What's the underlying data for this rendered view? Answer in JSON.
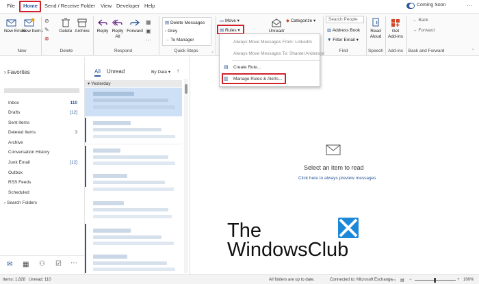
{
  "tabs": [
    "File",
    "Home",
    "Send / Receive",
    "Folder",
    "View",
    "Developer",
    "Help"
  ],
  "coming_soon": "Coming Soon",
  "toggle_state": "On",
  "ribbon": {
    "new_email": "New Email",
    "new_items": "New Items",
    "delete": "Delete",
    "archive": "Archive",
    "reply": "Reply",
    "reply_all": "Reply All",
    "forward": "Forward",
    "quick_steps": [
      "Delete Messages",
      "Grey",
      "To Manager"
    ],
    "move": "Move",
    "rules": "Rules",
    "unread": "Unread/",
    "categorize": "Categorize",
    "search_people": "Search People",
    "address_book": "Address Book",
    "filter_email": "Filter Email",
    "read_aloud": "Read Aloud",
    "get_addins": "Get Add-ins",
    "back": "Back",
    "forward_nav": "Forward",
    "groups": {
      "new": "New",
      "delete": "Delete",
      "respond": "Respond",
      "quick_steps": "Quick Steps",
      "find": "Find",
      "speech": "Speech",
      "addins": "Add-ins",
      "back_forward": "Back and Forward"
    }
  },
  "rules_menu": {
    "item1": "Always Move Messages From: LinkedIn",
    "item2": "Always Move Messages To: Shantel Anderson",
    "create_rule": "Create Rule...",
    "manage_rules": "Manage Rules & Alerts..."
  },
  "favorites": "Favorites",
  "folders": [
    {
      "name": "Inbox",
      "count": "110"
    },
    {
      "name": "Drafts",
      "count": "[12]"
    },
    {
      "name": "Sent Items",
      "count": ""
    },
    {
      "name": "Deleted Items",
      "count": "3"
    },
    {
      "name": "Archive",
      "count": ""
    },
    {
      "name": "Conversation History",
      "count": ""
    },
    {
      "name": "Junk Email",
      "count": "[12]"
    },
    {
      "name": "Outbox",
      "count": ""
    },
    {
      "name": "RSS Feeds",
      "count": ""
    },
    {
      "name": "Scheduled",
      "count": ""
    },
    {
      "name": "Search Folders",
      "count": ""
    }
  ],
  "list": {
    "all": "All",
    "unread": "Unread",
    "sort": "By Date",
    "section": "Yesterday"
  },
  "reading": {
    "select": "Select an item to read",
    "preview_link": "Click here to always preview messages"
  },
  "watermark": {
    "line1": "The",
    "line2": "WindowsClub"
  },
  "status": {
    "items": "Items: 1,828",
    "unread": "Unread: 110",
    "folders": "All folders are up to date.",
    "connected": "Connected to: Microsoft Exchange",
    "zoom": "100%"
  },
  "colors": {
    "accent": "#2b579a",
    "highlight": "#d0202a"
  }
}
